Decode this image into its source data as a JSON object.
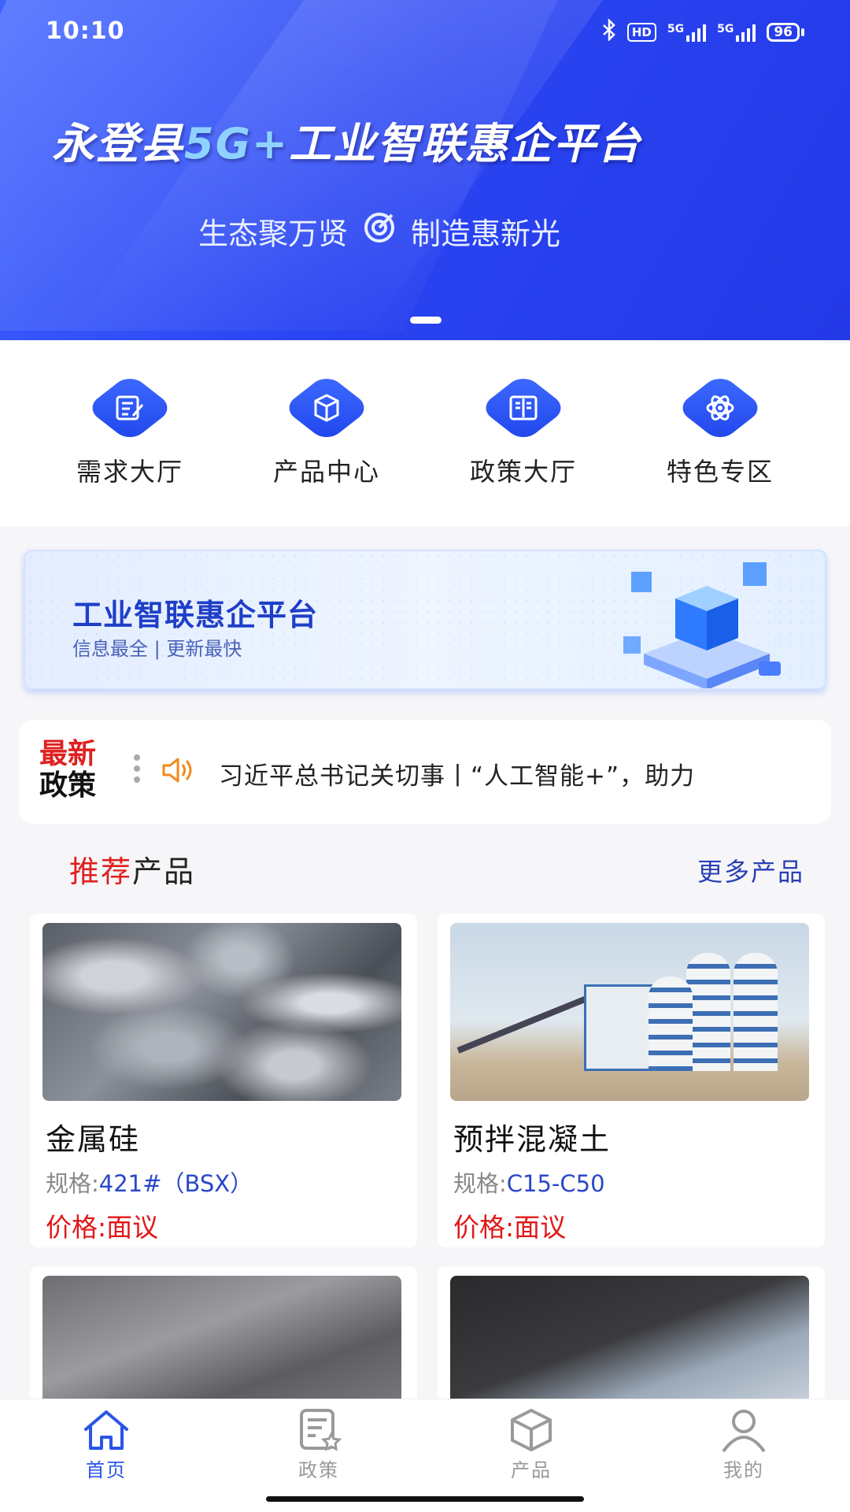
{
  "status_bar": {
    "time": "10:10",
    "hd": "HD",
    "net1": "5G",
    "net2": "5G",
    "battery": "96"
  },
  "banner": {
    "title_pre": "永登县",
    "title_hl": "5G+",
    "title_post": "工业智联惠企平台",
    "slogan_left": "生态聚万贤",
    "slogan_right": "制造惠新光"
  },
  "quick_nav": [
    {
      "label": "需求大厅",
      "icon": "edit-doc-icon"
    },
    {
      "label": "产品中心",
      "icon": "box-icon"
    },
    {
      "label": "政策大厅",
      "icon": "book-icon"
    },
    {
      "label": "特色专区",
      "icon": "atom-icon"
    }
  ],
  "promo": {
    "title": "工业智联惠企平台",
    "subtitle": "信息最全 | 更新最快"
  },
  "news": {
    "label_top": "最新",
    "label_bottom": "政策",
    "text": "习近平总书记关切事丨“人工智能+”，助力"
  },
  "section": {
    "title_red": "推荐",
    "title_rest": "产品",
    "more": "更多产品"
  },
  "products": [
    {
      "name": "金属硅",
      "spec_label": "规格:",
      "spec_value": "421#（BSX）",
      "price": "价格:面议"
    },
    {
      "name": "预拌混凝土",
      "spec_label": "规格:",
      "spec_value": "C15-C50",
      "price": "价格:面议"
    }
  ],
  "tabs": [
    {
      "label": "首页",
      "icon": "home-icon",
      "active": true
    },
    {
      "label": "政策",
      "icon": "policy-doc-icon",
      "active": false
    },
    {
      "label": "产品",
      "icon": "cube-icon",
      "active": false
    },
    {
      "label": "我的",
      "icon": "user-icon",
      "active": false
    }
  ],
  "colors": {
    "primary": "#2a55e8",
    "price_red": "#e01818",
    "banner_blue": "#2a45f3"
  }
}
